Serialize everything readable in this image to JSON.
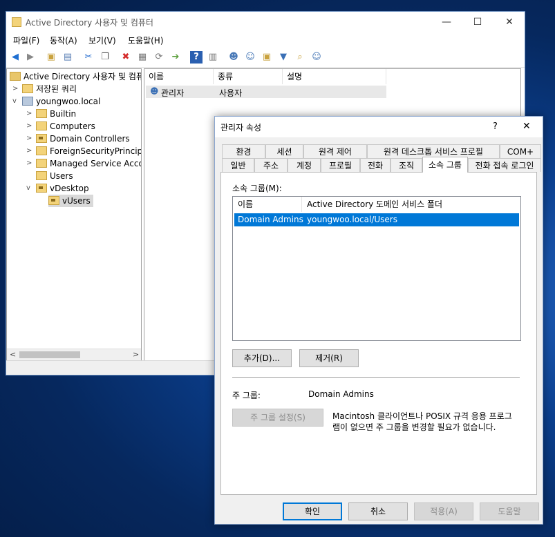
{
  "main_window": {
    "title": "Active Directory 사용자 및 컴퓨터",
    "controls": {
      "minimize": "—",
      "maximize": "☐",
      "close": "✕"
    },
    "menu": [
      "파일(F)",
      "동작(A)",
      "보기(V)",
      "도움말(H)"
    ],
    "tree": {
      "root": "Active Directory 사용자 및 컴퓨",
      "saved_queries": "저장된 쿼리",
      "domain": "youngwoo.local",
      "children": [
        "Builtin",
        "Computers",
        "Domain Controllers",
        "ForeignSecurityPrincipals",
        "Managed Service Accou",
        "Users",
        "vDesktop"
      ],
      "vdesktop_child": "vUsers"
    },
    "list": {
      "columns": [
        "이름",
        "종류",
        "설명"
      ],
      "rows": [
        {
          "name": "관리자",
          "type": "사용자",
          "desc": ""
        }
      ]
    }
  },
  "dialog": {
    "title": "관리자 속성",
    "help": "?",
    "close": "✕",
    "tabs_row1": [
      "환경",
      "세션",
      "원격 제어",
      "원격 데스크톱 서비스 프로필",
      "COM+"
    ],
    "tabs_row2": [
      "일반",
      "주소",
      "계정",
      "프로필",
      "전화",
      "조직",
      "소속 그룹",
      "전화 접속 로그인"
    ],
    "active_tab": "소속 그룹",
    "member_of_label": "소속 그룹(M):",
    "member_columns": [
      "이름",
      "Active Directory 도메인 서비스 폴더"
    ],
    "members": [
      {
        "name": "Domain Admins",
        "folder": "youngwoo.local/Users"
      }
    ],
    "add_button": "추가(D)...",
    "remove_button": "제거(R)",
    "primary_group_label": "주 그룹:",
    "primary_group_value": "Domain Admins",
    "set_primary_button": "주 그룹 설정(S)",
    "info_line1": "Macintosh 클라이언트나 POSIX 규격 응용 프로그",
    "info_line2": "램이 없으면 주 그룹을 변경할 필요가 없습니다.",
    "ok": "확인",
    "cancel": "취소",
    "apply": "적용(A)",
    "help_button": "도움말"
  },
  "colors": {
    "selection": "#0078d7",
    "accent": "#0078d7",
    "desktop": "#0b3f8e"
  }
}
